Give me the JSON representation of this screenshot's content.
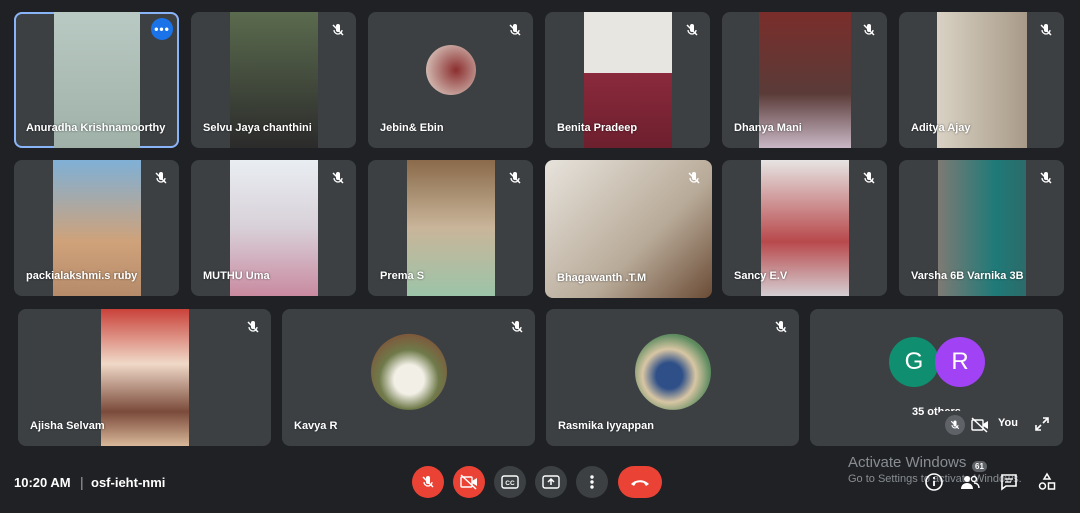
{
  "meeting": {
    "time": "10:20 AM",
    "code": "osf-ieht-nmi",
    "participant_count": "61"
  },
  "participants": [
    {
      "name": "Anuradha Krishnamoorthy",
      "active": true
    },
    {
      "name": "Selvu Jaya chanthini"
    },
    {
      "name": "Jebin& Ebin"
    },
    {
      "name": "Benita Pradeep"
    },
    {
      "name": "Dhanya Mani"
    },
    {
      "name": "Aditya Ajay"
    },
    {
      "name": "packialakshmi.s ruby"
    },
    {
      "name": "MUTHU Uma"
    },
    {
      "name": "Prema S"
    },
    {
      "name": "Bhagawanth .T.M"
    },
    {
      "name": "Sancy E.V"
    },
    {
      "name": "Varsha 6B Varnika 3B"
    },
    {
      "name": "Ajisha Selvam"
    },
    {
      "name": "Kavya R"
    },
    {
      "name": "Rasmika Iyyappan"
    }
  ],
  "others": {
    "initials": [
      "G",
      "R"
    ],
    "colors": [
      "#0f8f6f",
      "#a142f4"
    ],
    "label": "35 others"
  },
  "self_view": {
    "label": "You"
  },
  "watermark": {
    "line1": "Activate Windows",
    "line2": "Go to Settings to activate Windows."
  },
  "colors": {
    "background": "#202124",
    "tile": "#3c4043",
    "danger": "#ea4335",
    "active_border": "#8ab4f8"
  }
}
